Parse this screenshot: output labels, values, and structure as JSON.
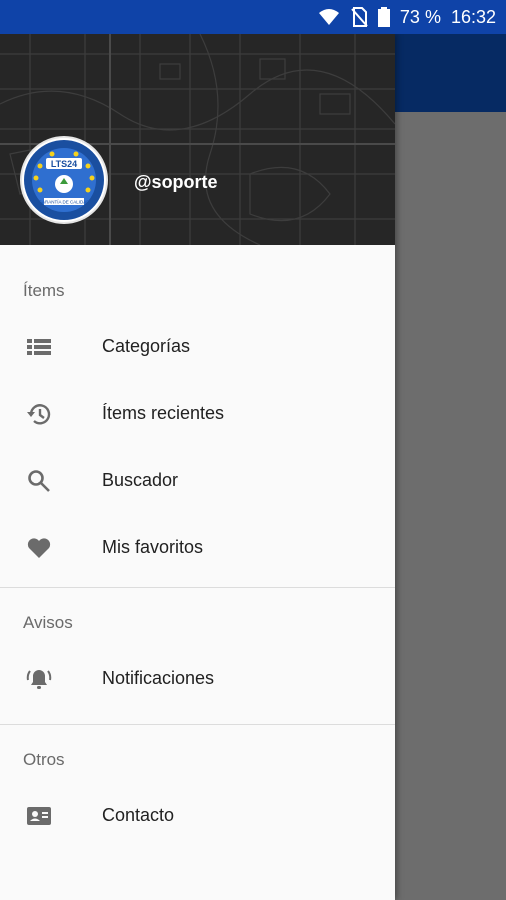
{
  "status_bar": {
    "battery_percent": "73 %",
    "time": "16:32",
    "icons": [
      "wifi-icon",
      "no-sim-icon",
      "battery-icon"
    ]
  },
  "drawer": {
    "header": {
      "username": "@soporte",
      "logo_text": "LTS24",
      "logo_caption": "GARANTÍA DE CALIDAD"
    },
    "sections": [
      {
        "label": "Ítems",
        "items": [
          {
            "label": "Categorías",
            "icon": "list-icon"
          },
          {
            "label": "Ítems recientes",
            "icon": "history-icon"
          },
          {
            "label": "Buscador",
            "icon": "search-icon"
          },
          {
            "label": "Mis favoritos",
            "icon": "heart-icon"
          }
        ]
      },
      {
        "label": "Avisos",
        "items": [
          {
            "label": "Notificaciones",
            "icon": "bell-icon"
          }
        ]
      },
      {
        "label": "Otros",
        "items": [
          {
            "label": "Contacto",
            "icon": "contact-card-icon"
          }
        ]
      }
    ]
  },
  "colors": {
    "status_bar": "#0f43a8",
    "app_bar": "#062a63",
    "drawer_header": "#262626",
    "scrim": "#6d6d6d"
  }
}
